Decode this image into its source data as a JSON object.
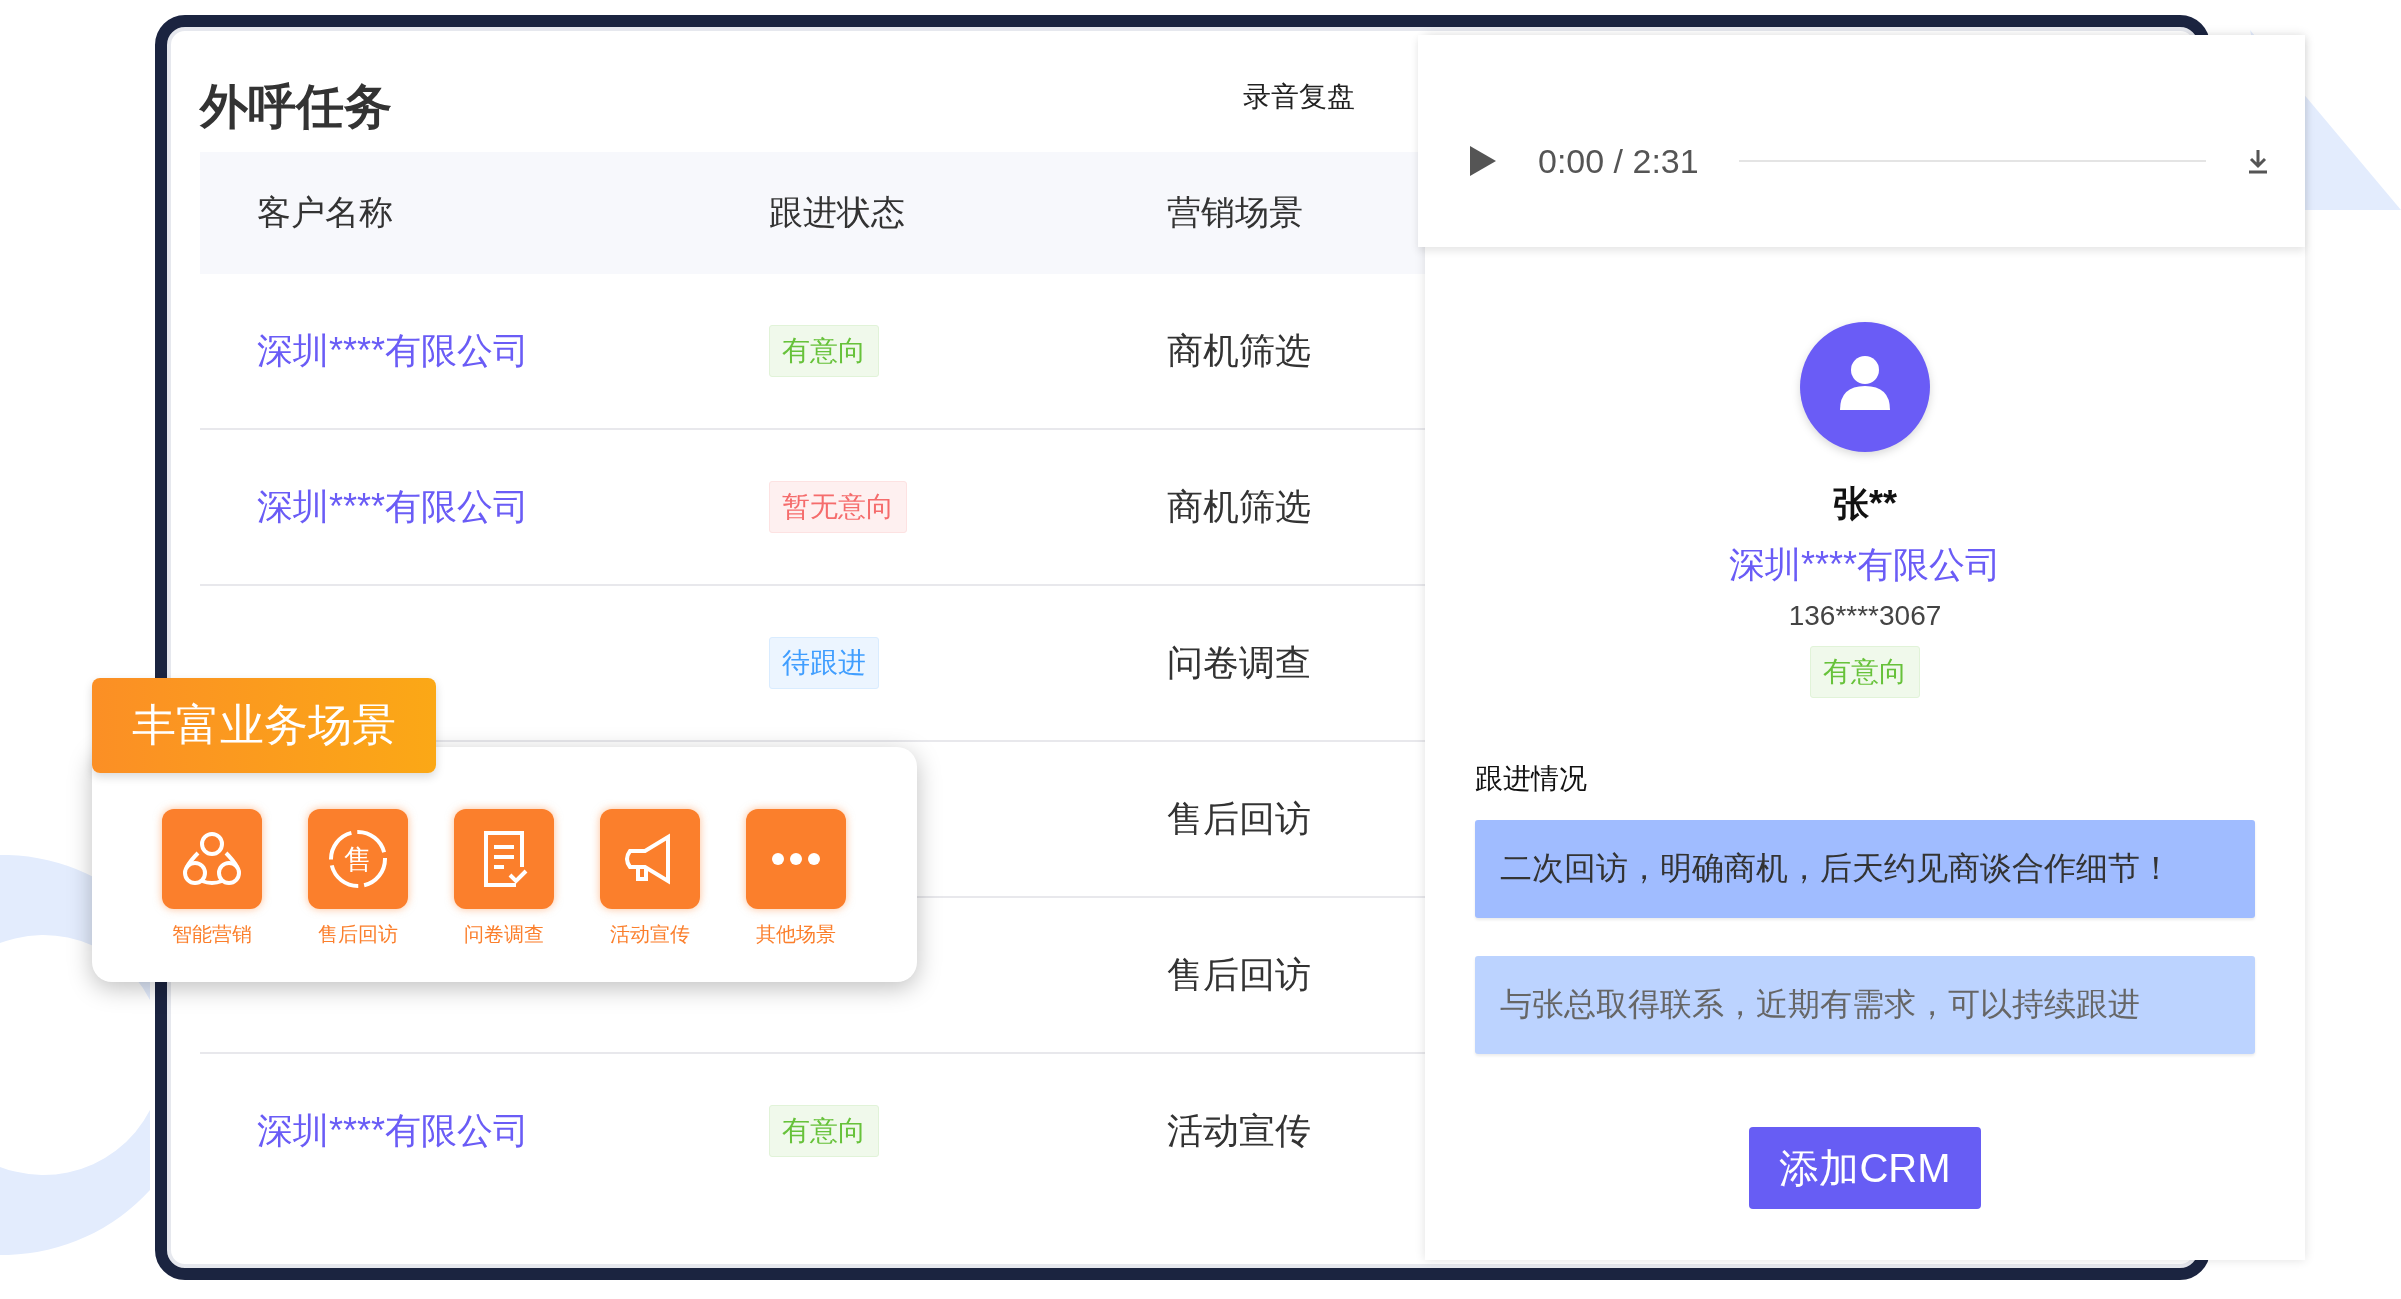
{
  "panel": {
    "title": "外呼任务",
    "tab": "录音复盘"
  },
  "table": {
    "columns": [
      "客户名称",
      "跟进状态",
      "营销场景"
    ],
    "rows": [
      {
        "company": "深圳****有限公司",
        "status": {
          "label": "有意向",
          "kind": "positive"
        },
        "scene": "商机筛选"
      },
      {
        "company": "深圳****有限公司",
        "status": {
          "label": "暂无意向",
          "kind": "negative"
        },
        "scene": "商机筛选"
      },
      {
        "status": {
          "label": "待跟进",
          "kind": "pending"
        },
        "scene": "问卷调查"
      },
      {
        "scene": "售后回访"
      },
      {
        "scene": "售后回访"
      },
      {
        "company": "深圳****有限公司",
        "status": {
          "label": "有意向",
          "kind": "positive"
        },
        "scene": "活动宣传"
      }
    ]
  },
  "scenario_card": {
    "title": "丰富业务场景",
    "items": [
      {
        "label": "智能营销",
        "kind": "people"
      },
      {
        "label": "售后回访",
        "kind": "glyph",
        "glyph": "售"
      },
      {
        "label": "问卷调查",
        "kind": "survey"
      },
      {
        "label": "活动宣传",
        "kind": "megaphone"
      },
      {
        "label": "其他场景",
        "kind": "more"
      }
    ]
  },
  "player": {
    "time": "0:00 / 2:31"
  },
  "contact": {
    "name": "张**",
    "company": "深圳****有限公司",
    "phone": "136****3067",
    "status": {
      "label": "有意向",
      "kind": "positive"
    }
  },
  "follow_up": {
    "title": "跟进情况",
    "notes": [
      {
        "text": "二次回访，明确商机，后天约见商谈合作细节！",
        "selected": true
      },
      {
        "text": "与张总取得联系，近期有需求，可以持续跟进",
        "selected": false
      }
    ]
  },
  "button": "添加CRM"
}
